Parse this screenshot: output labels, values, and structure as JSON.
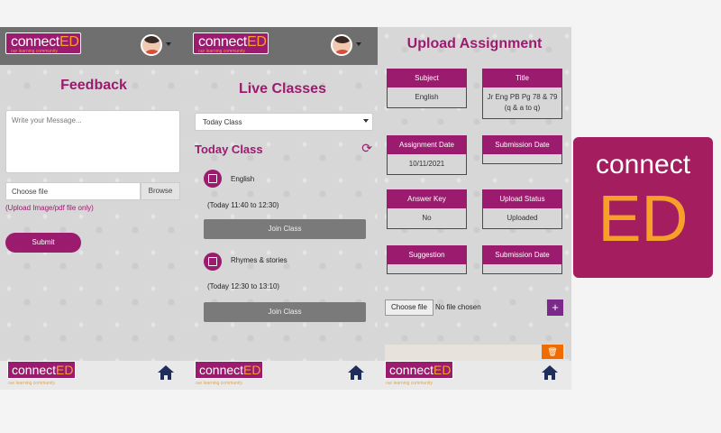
{
  "brand": {
    "logo_main": "connect",
    "logo_accent": "ED",
    "tagline": "our learning community",
    "big_logo_line1": "connect",
    "big_logo_line2": "ED"
  },
  "feedback": {
    "title": "Feedback",
    "message_placeholder": "Write your Message...",
    "choose_file": "Choose file",
    "browse": "Browse",
    "hint": "(Upload Image/pdf file only)",
    "submit": "Submit"
  },
  "live": {
    "title": "Live Classes",
    "select_value": "Today Class",
    "section": "Today Class",
    "join": "Join Class",
    "classes": [
      {
        "name": "English",
        "time": "(Today 11:40 to 12:30)"
      },
      {
        "name": "Rhymes & stories",
        "time": "(Today 12:30 to 13:10)"
      }
    ]
  },
  "upload": {
    "title": "Upload Assignment",
    "subject_label": "Subject",
    "subject_value": "English",
    "title_label": "Title",
    "title_value": "Jr Eng PB Pg 78 & 79 (q & a to q)",
    "assignment_date_label": "Assignment Date",
    "assignment_date_value": "10/11/2021",
    "submission_date_label": "Submission Date",
    "submission_date_value": "",
    "answer_key_label": "Answer Key",
    "answer_key_value": "No",
    "upload_status_label": "Upload Status",
    "upload_status_value": "Uploaded",
    "suggestion_label": "Suggestion",
    "suggestion_value": "",
    "submission_date2_label": "Submission Date",
    "submission_date2_value": "",
    "choose_file": "Choose file",
    "no_file": "No file chosen",
    "add": "+",
    "delete": "🗑"
  },
  "colors": {
    "brand": "#9b1b6e",
    "accent": "#f6a02a",
    "navy": "#1f2d5c"
  },
  "icons": {
    "home": "home-icon",
    "refresh": "refresh-icon",
    "class": "class-icon",
    "trash": "trash-icon"
  }
}
